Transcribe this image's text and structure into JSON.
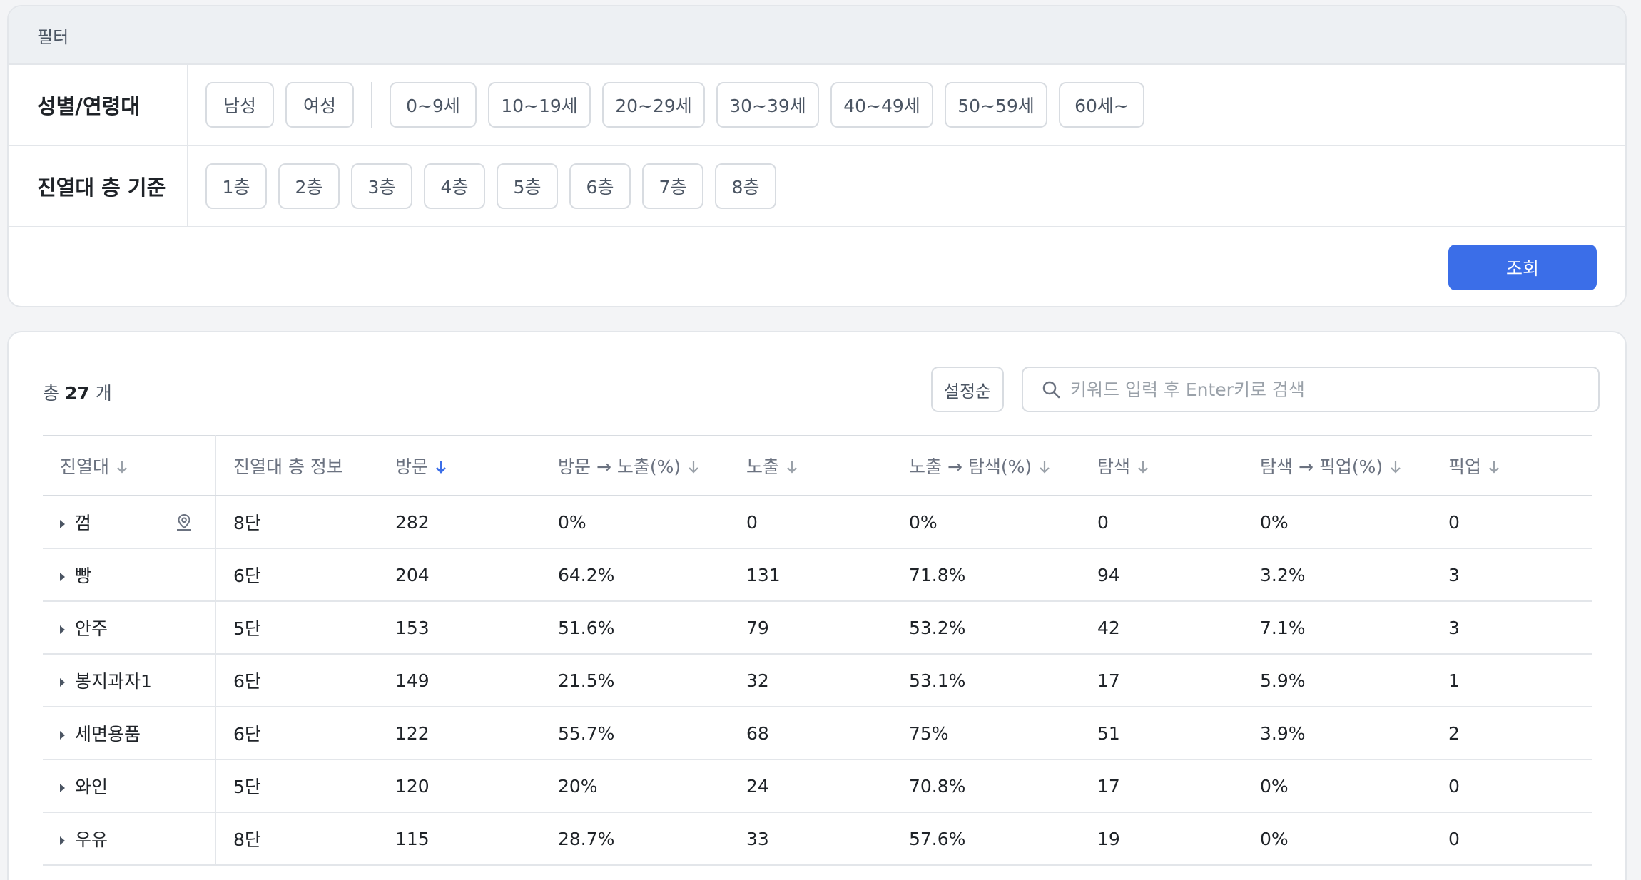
{
  "filter": {
    "title": "필터",
    "gender_age_label": "성별/연령대",
    "gender_chips": [
      "남성",
      "여성"
    ],
    "age_chips": [
      "0~9세",
      "10~19세",
      "20~29세",
      "30~39세",
      "40~49세",
      "50~59세",
      "60세~"
    ],
    "floor_label": "진열대 층 기준",
    "floor_chips": [
      "1층",
      "2층",
      "3층",
      "4층",
      "5층",
      "6층",
      "7층",
      "8층"
    ],
    "submit_label": "조회"
  },
  "list": {
    "total_prefix": "총",
    "total_count": "27",
    "total_suffix": "개",
    "sort_label": "설정순",
    "search_placeholder": "키워드 입력 후 Enter키로 검색",
    "search_value": ""
  },
  "table": {
    "headers": [
      "진열대",
      "진열대 층 정보",
      "방문",
      "방문 → 노출(%)",
      "노출",
      "노출 → 탐색(%)",
      "탐색",
      "탐색 → 픽업(%)",
      "픽업"
    ],
    "rows": [
      [
        "껌",
        "8단",
        "282",
        "0%",
        "0",
        "0%",
        "0",
        "0%",
        "0"
      ],
      [
        "빵",
        "6단",
        "204",
        "64.2%",
        "131",
        "71.8%",
        "94",
        "3.2%",
        "3"
      ],
      [
        "안주",
        "5단",
        "153",
        "51.6%",
        "79",
        "53.2%",
        "42",
        "7.1%",
        "3"
      ],
      [
        "봉지과자1",
        "6단",
        "149",
        "21.5%",
        "32",
        "53.1%",
        "17",
        "5.9%",
        "1"
      ],
      [
        "세면용품",
        "6단",
        "122",
        "55.7%",
        "68",
        "75%",
        "51",
        "3.9%",
        "2"
      ],
      [
        "와인",
        "5단",
        "120",
        "20%",
        "24",
        "70.8%",
        "17",
        "0%",
        "0"
      ],
      [
        "우유",
        "8단",
        "115",
        "28.7%",
        "33",
        "57.6%",
        "19",
        "0%",
        "0"
      ]
    ]
  },
  "colors": {
    "accent": "#3b6ee8",
    "border": "#e3e6ea",
    "header_bg": "#edf0f3"
  }
}
